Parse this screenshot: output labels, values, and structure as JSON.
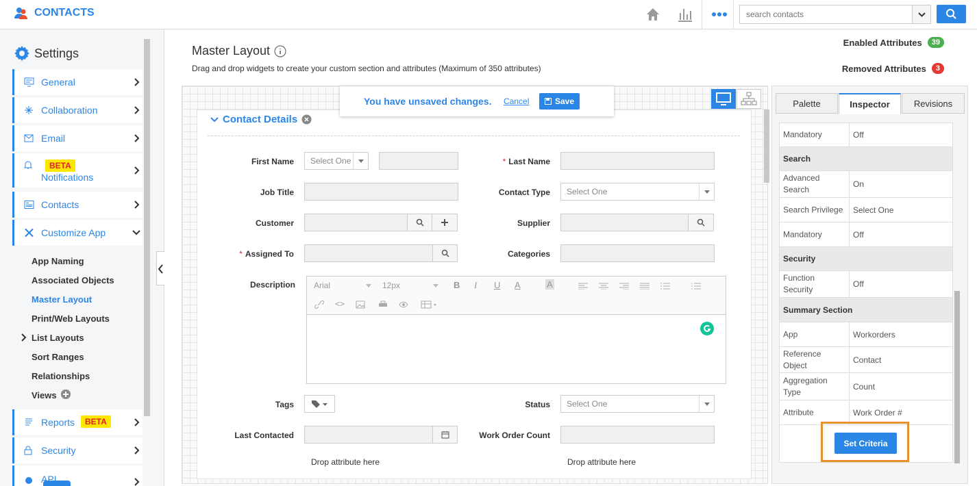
{
  "app": {
    "title": "CONTACTS"
  },
  "search": {
    "placeholder": "search contacts"
  },
  "sidebar": {
    "title": "Settings",
    "items": [
      {
        "label": "General"
      },
      {
        "label": "Collaboration"
      },
      {
        "label": "Email"
      },
      {
        "label": "Notifications",
        "badge": "BETA"
      },
      {
        "label": "Contacts"
      },
      {
        "label": "Customize App"
      },
      {
        "label": "Reports",
        "badge": "BETA"
      },
      {
        "label": "Security"
      },
      {
        "label": "API"
      }
    ],
    "sub_items": [
      "App Naming",
      "Associated Objects",
      "Master Layout",
      "Print/Web Layouts",
      "List Layouts",
      "Sort Ranges",
      "Relationships",
      "Views"
    ]
  },
  "page": {
    "title": "Master Layout",
    "subtitle": "Drag and drop widgets to create your custom section and attributes (Maximum of 350 attributes)"
  },
  "stats": {
    "enabled_label": "Enabled Attributes",
    "enabled_count": "39",
    "enabled_color": "#4caf50",
    "removed_label": "Removed Attributes",
    "removed_count": "3",
    "removed_color": "#e53935"
  },
  "unsaved": {
    "message": "You have unsaved changes.",
    "cancel": "Cancel",
    "save": "Save"
  },
  "section": {
    "title": "Contact Details"
  },
  "form": {
    "first_name": "First Name",
    "select_one": "Select One",
    "last_name": "Last Name",
    "job_title": "Job Title",
    "contact_type": "Contact Type",
    "customer": "Customer",
    "supplier": "Supplier",
    "assigned_to": "Assigned To",
    "categories": "Categories",
    "description": "Description",
    "tags": "Tags",
    "status": "Status",
    "last_contacted": "Last Contacted",
    "work_order_count": "Work Order Count",
    "drop_hint": "Drop attribute here"
  },
  "editor": {
    "font": "Arial",
    "size": "12px"
  },
  "inspector": {
    "tabs": [
      "Palette",
      "Inspector",
      "Revisions"
    ],
    "rows": {
      "r1": {
        "k": "Mandatory",
        "v": "Off"
      },
      "search": "Search",
      "r2": {
        "k": "Advanced Search",
        "v": "On"
      },
      "r3": {
        "k": "Search Privilege",
        "v": "Select One"
      },
      "r4": {
        "k": "Mandatory",
        "v": "Off"
      },
      "security": "Security",
      "r5": {
        "k": "Function Security",
        "v": "Off"
      },
      "summary": "Summary Section",
      "r6": {
        "k": "App",
        "v": "Workorders"
      },
      "r7": {
        "k": "Reference Object",
        "v": "Contact"
      },
      "r8": {
        "k": "Aggregation Type",
        "v": "Count"
      },
      "r9": {
        "k": "Attribute",
        "v": "Work Order #"
      }
    },
    "set_criteria": "Set Criteria"
  },
  "colors": {
    "accent": "#2c86e6",
    "highlight": "#e8902c",
    "beta": "#ffe600"
  }
}
